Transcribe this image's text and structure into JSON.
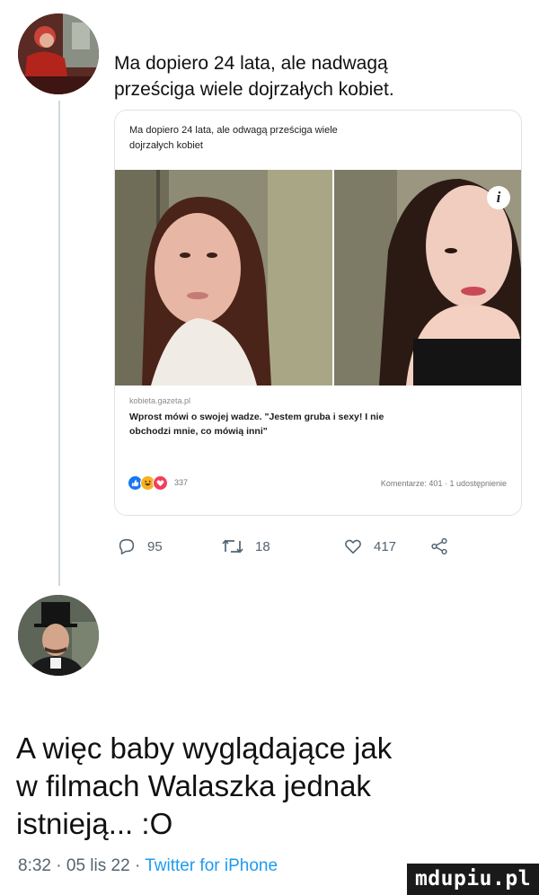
{
  "tweet": {
    "text_line1": "Ma dopiero 24 lata, ale nadwagą",
    "text_line2": "prześciga wiele dojrzałych kobiet.",
    "avatar_icon": "user-avatar-red-costume"
  },
  "card": {
    "headline_line1": "Ma dopiero 24 lata, ale odwagą prześciga wiele",
    "headline_line2": "dojrzałych kobiet",
    "info_icon": "i",
    "domain": "kobieta.gazeta.pl",
    "title_line1": "Wprost mówi o swojej wadze. \"Jestem gruba i sexy! I nie",
    "title_line2": "obchodzi mnie, co mówią inni\"",
    "reactions_count": "337",
    "stats": "Komentarze: 401 · 1 udostępnienie",
    "colors": {
      "like": "#1877f2",
      "haha": "#f7b125",
      "love": "#f33e58"
    }
  },
  "actions": {
    "reply_count": "95",
    "retweet_count": "18",
    "like_count": "417"
  },
  "reply": {
    "line1": "A więc baby wyglądające jak",
    "line2": "w filmach Walaszka jednak",
    "line3": "istnieją... :O",
    "avatar_icon": "user-avatar-top-hat"
  },
  "meta": {
    "time": "8:32",
    "date": "05 lis 22",
    "source": "Twitter for iPhone"
  },
  "watermark": "mdupiu.pl"
}
